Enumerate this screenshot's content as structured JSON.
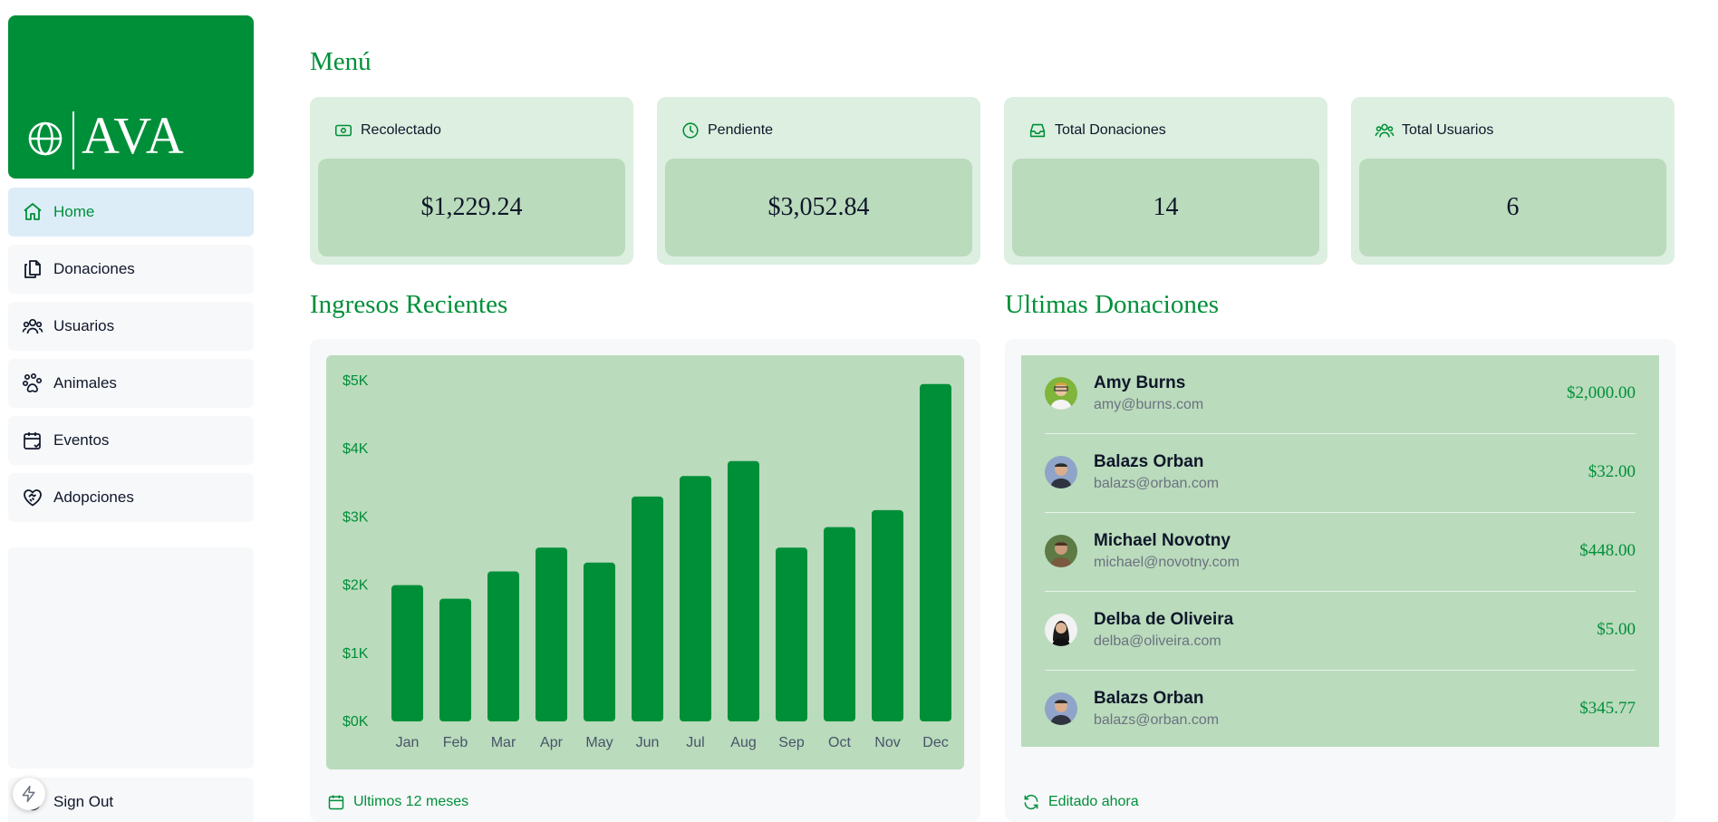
{
  "brand": {
    "name": "AVA",
    "color": "#008f39"
  },
  "sidebar": {
    "items": [
      {
        "label": "Home",
        "icon": "home-icon",
        "active": true
      },
      {
        "label": "Donaciones",
        "icon": "documents-icon",
        "active": false
      },
      {
        "label": "Usuarios",
        "icon": "users-icon",
        "active": false
      },
      {
        "label": "Animales",
        "icon": "paw-icon",
        "active": false
      },
      {
        "label": "Eventos",
        "icon": "calendar-check-icon",
        "active": false
      },
      {
        "label": "Adopciones",
        "icon": "heart-handshake-icon",
        "active": false
      }
    ],
    "signout_label": "Sign Out"
  },
  "menu": {
    "title": "Menú",
    "cards": [
      {
        "label": "Recolectado",
        "value": "$1,229.24",
        "icon": "banknote-icon"
      },
      {
        "label": "Pendiente",
        "value": "$3,052.84",
        "icon": "clock-icon"
      },
      {
        "label": "Total Donaciones",
        "value": "14",
        "icon": "inbox-icon"
      },
      {
        "label": "Total Usuarios",
        "value": "6",
        "icon": "users-icon"
      }
    ]
  },
  "ingresos": {
    "title": "Ingresos Recientes",
    "footer": "Ultimos 12 meses",
    "footer_icon": "calendar-icon"
  },
  "chart_data": {
    "type": "bar",
    "categories": [
      "Jan",
      "Feb",
      "Mar",
      "Apr",
      "May",
      "Jun",
      "Jul",
      "Aug",
      "Sep",
      "Oct",
      "Nov",
      "Dec"
    ],
    "values": [
      2000,
      1800,
      2200,
      2550,
      2330,
      3300,
      3600,
      3820,
      2550,
      2850,
      3100,
      4950
    ],
    "yticks": [
      "$0K",
      "$1K",
      "$2K",
      "$3K",
      "$4K",
      "$5K"
    ],
    "ylim": [
      0,
      5000
    ],
    "bar_color": "#008f39",
    "tick_color": "#008f39"
  },
  "ultimas": {
    "title": "Ultimas Donaciones",
    "footer": "Editado ahora",
    "footer_icon": "refresh-icon",
    "rows": [
      {
        "name": "Amy Burns",
        "email": "amy@burns.com",
        "amount": "$2,000.00"
      },
      {
        "name": "Balazs Orban",
        "email": "balazs@orban.com",
        "amount": "$32.00"
      },
      {
        "name": "Michael Novotny",
        "email": "michael@novotny.com",
        "amount": "$448.00"
      },
      {
        "name": "Delba de Oliveira",
        "email": "delba@oliveira.com",
        "amount": "$5.00"
      },
      {
        "name": "Balazs Orban",
        "email": "balazs@orban.com",
        "amount": "$345.77"
      }
    ]
  }
}
